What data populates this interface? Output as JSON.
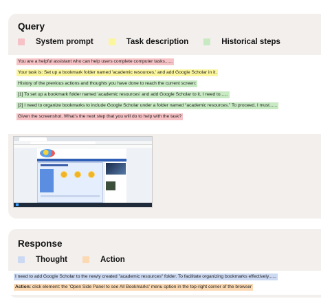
{
  "query": {
    "title": "Query",
    "legend": [
      {
        "label": "System prompt",
        "color": "#f7c2c6"
      },
      {
        "label": "Task description",
        "color": "#fbf59c"
      },
      {
        "label": "Historical steps",
        "color": "#c7eac3"
      }
    ],
    "lines": {
      "system": "You are a helpful assistant who can help users complete computer tasks......",
      "task": "Your task is: Set up a bookmark folder named 'academic resources,' and add Google Scholar in it.",
      "history_intro": "History of the previous actions and thoughts you have done to reach the current screen:",
      "step1": "[1] To set up a bookmark folder named 'academic resources' and add Google Scholar to it, I need to......",
      "step2": "[2] I need to organize bookmarks to include Google Scholar under a folder named “academic resources.” To proceed, I must......",
      "question": "Given the screenshot. What's the next step that you will do to help with the task?"
    }
  },
  "response": {
    "title": "Response",
    "legend": [
      {
        "label": "Thought",
        "color": "#ccd9f3"
      },
      {
        "label": "Action",
        "color": "#fbd9b3"
      }
    ],
    "thought": "I need to add Google Scholar to the newly created \"academic resources\" folder. To facilitate organizing bookmarks effectively......",
    "action_prefix": "Action:",
    "action": " click element: the 'Open Side Panel to see All Bookmarks' menu option in the top-right corner of the browser"
  }
}
